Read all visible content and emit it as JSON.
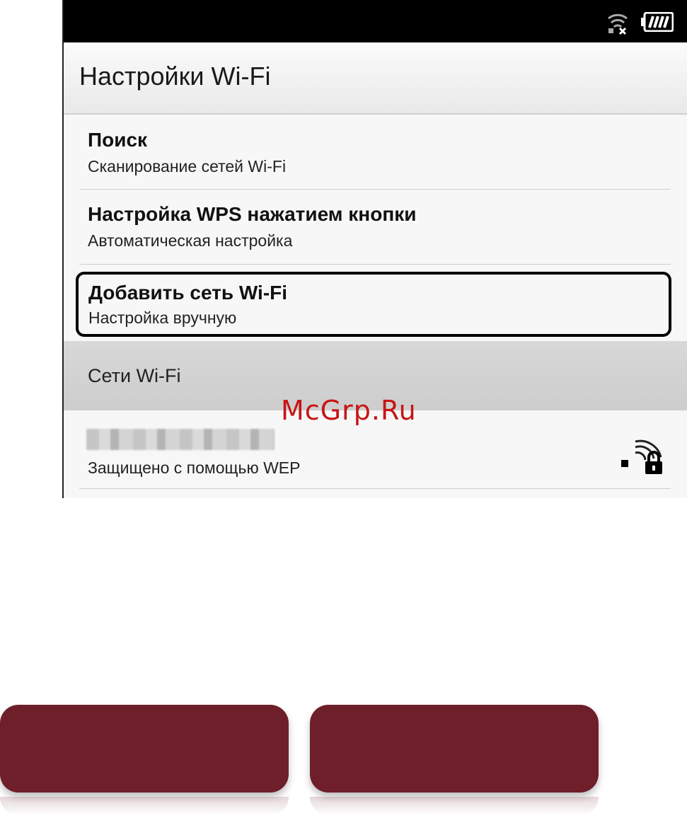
{
  "status_bar": {
    "wifi_icon": "wifi-disconnected-icon",
    "battery_icon": "battery-full-icon"
  },
  "header": {
    "title": "Настройки Wi-Fi"
  },
  "menu": {
    "items": [
      {
        "title": "Поиск",
        "subtitle": "Сканирование сетей Wi-Fi"
      },
      {
        "title": "Настройка WPS нажатием кнопки",
        "subtitle": "Автоматическая настройка"
      },
      {
        "title": "Добавить сеть Wi-Fi",
        "subtitle": "Настройка вручную"
      }
    ]
  },
  "networks": {
    "section_title": "Сети Wi-Fi",
    "items": [
      {
        "security": "Защищено с помощью WEP",
        "icon": "wifi-lock-icon"
      }
    ]
  },
  "watermark": "McGrp.Ru",
  "colors": {
    "accent_button": "#6e1f2a",
    "watermark": "#c81414"
  }
}
